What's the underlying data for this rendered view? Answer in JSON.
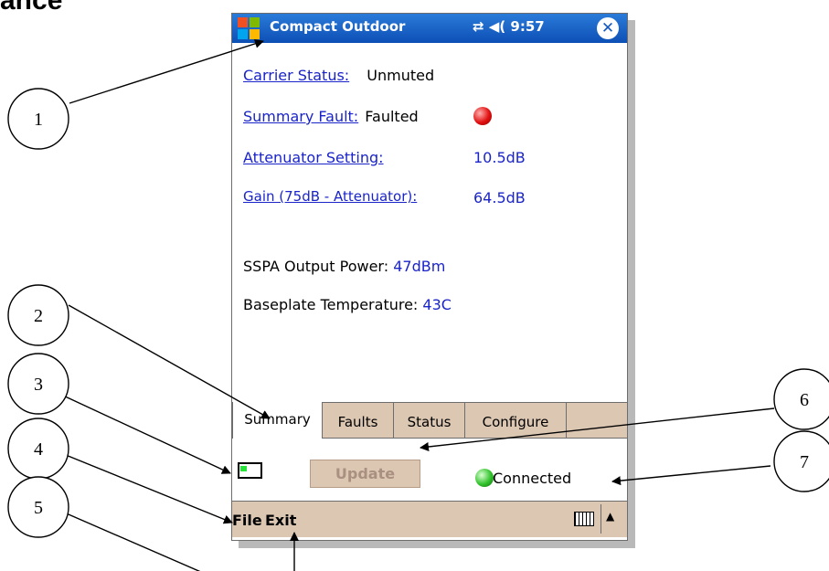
{
  "document": {
    "heading_fragment": "ance"
  },
  "app": {
    "title": "Compact Outdoor",
    "status_icons": "⇄ ◀( 9:57",
    "close_glyph": "✕"
  },
  "summary": {
    "carrier_status": {
      "label": "Carrier Status:",
      "value": "Unmuted"
    },
    "summary_fault": {
      "label": "Summary Fault:",
      "value": "Faulted",
      "indicator_color": "#e21010"
    },
    "attenuator": {
      "label": "Attenuator Setting:",
      "value": "10.5dB"
    },
    "gain": {
      "label": "Gain (75dB - Attenuator):",
      "value": "64.5dB"
    },
    "ssp_output": {
      "label": "SSPA Output Power:",
      "value": "47dBm"
    },
    "baseplate_temp": {
      "label": "Baseplate Temperature:",
      "value": "43C"
    }
  },
  "tabs": [
    {
      "label": "Summary",
      "active": true
    },
    {
      "label": "Faults",
      "active": false
    },
    {
      "label": "Status",
      "active": false
    },
    {
      "label": "Configure",
      "active": false
    }
  ],
  "actions": {
    "update_label": "Update",
    "connection_status": "Connected",
    "connection_color": "#31c22b"
  },
  "menu": {
    "file_label": "File",
    "exit_label": "Exit",
    "keyboard_icon": "keyboard-icon",
    "sip_arrow": "▲"
  },
  "callouts": [
    "1",
    "2",
    "3",
    "4",
    "5",
    "6",
    "7"
  ]
}
